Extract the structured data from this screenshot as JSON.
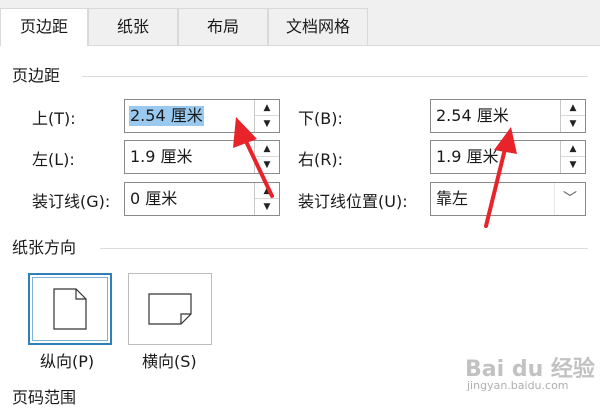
{
  "tabs": [
    {
      "label": "页边距",
      "active": true
    },
    {
      "label": "纸张",
      "active": false
    },
    {
      "label": "布局",
      "active": false
    },
    {
      "label": "文档网格",
      "active": false
    }
  ],
  "margins": {
    "title": "页边距",
    "top": {
      "label": "上(T):",
      "value": "2.54 厘米"
    },
    "bottom": {
      "label": "下(B):",
      "value": "2.54 厘米"
    },
    "left": {
      "label": "左(L):",
      "value": "1.9 厘米"
    },
    "right": {
      "label": "右(R):",
      "value": "1.9 厘米"
    },
    "gutter": {
      "label": "装订线(G):",
      "value": "0 厘米"
    },
    "gutter_position": {
      "label": "装订线位置(U):",
      "value": "靠左"
    }
  },
  "orientation": {
    "title": "纸张方向",
    "portrait_label": "纵向(P)",
    "landscape_label": "横向(S)",
    "selected": "portrait"
  },
  "pages": {
    "title": "页码范围"
  },
  "watermark": {
    "text": "Bai du 经验",
    "url": "jingyan.baidu.com"
  },
  "colors": {
    "accent": "#2f7fb9",
    "selection": "#99c9ef",
    "arrow": "#e8232a"
  }
}
